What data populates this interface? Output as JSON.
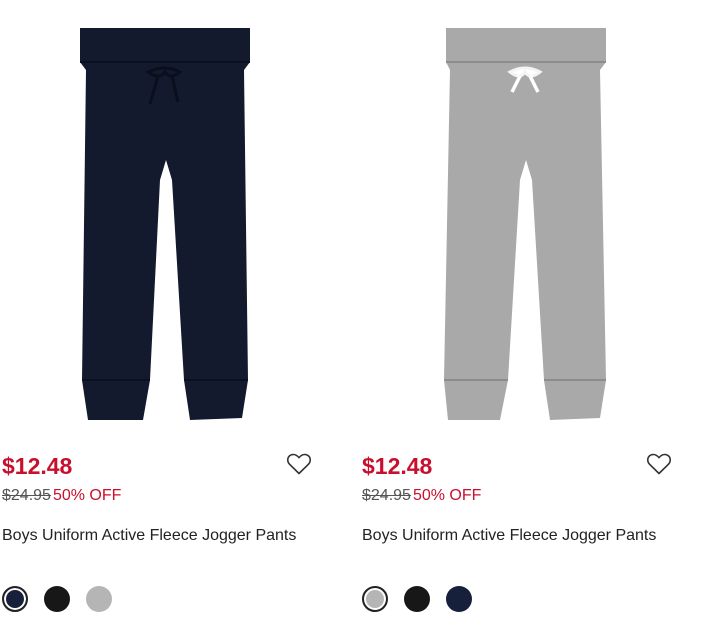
{
  "products": [
    {
      "sale_price": "$12.48",
      "original_price": "$24.95",
      "discount": "50% OFF",
      "title": "Boys Uniform Active Fleece Jogger Pants",
      "pant_color": "#131a2d",
      "favorite_icon": "heart-outline-icon",
      "swatches": [
        {
          "color": "#17203a",
          "selected": true
        },
        {
          "color": "#171717",
          "selected": false
        },
        {
          "color": "#b5b5b5",
          "selected": false
        }
      ]
    },
    {
      "sale_price": "$12.48",
      "original_price": "$24.95",
      "discount": "50% OFF",
      "title": "Boys Uniform Active Fleece Jogger Pants",
      "pant_color": "#a9a9a9",
      "favorite_icon": "heart-outline-icon",
      "swatches": [
        {
          "color": "#b5b5b5",
          "selected": true
        },
        {
          "color": "#171717",
          "selected": false
        },
        {
          "color": "#17203a",
          "selected": false
        }
      ]
    }
  ],
  "colors": {
    "sale": "#c8102e",
    "text": "#222222",
    "muted": "#555555"
  }
}
